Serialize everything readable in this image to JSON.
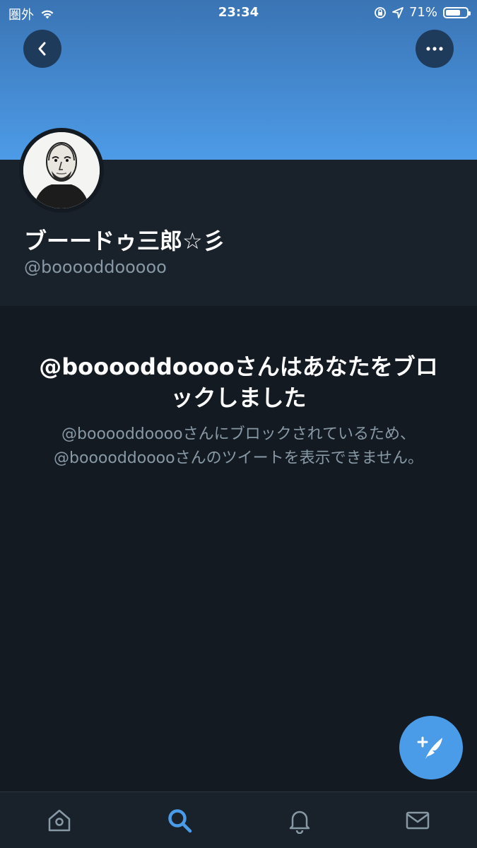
{
  "status_bar": {
    "carrier": "圏外",
    "time": "23:34",
    "battery": "71%",
    "battery_level": 0.71
  },
  "header": {
    "back_icon": "chevron-left-icon",
    "more_icon": "ellipsis-icon"
  },
  "profile": {
    "display_name": "ブーードゥ三郎☆彡",
    "handle": "@booooddooooo"
  },
  "blocked": {
    "title": "@booooddooooさんはあなたをブロックしました",
    "description": "@booooddooooさんにブロックされているため、@booooddooooさんのツイートを表示できません。"
  },
  "fab": {
    "icon": "compose-tweet-icon"
  },
  "tabbar": {
    "tabs": [
      {
        "name": "home",
        "icon": "home-icon",
        "active": false
      },
      {
        "name": "search",
        "icon": "search-icon",
        "active": true
      },
      {
        "name": "notifications",
        "icon": "bell-icon",
        "active": false
      },
      {
        "name": "messages",
        "icon": "mail-icon",
        "active": false
      }
    ]
  },
  "colors": {
    "accent": "#4a9ce8",
    "background": "#141a22",
    "secondary_text": "#8899a6"
  }
}
